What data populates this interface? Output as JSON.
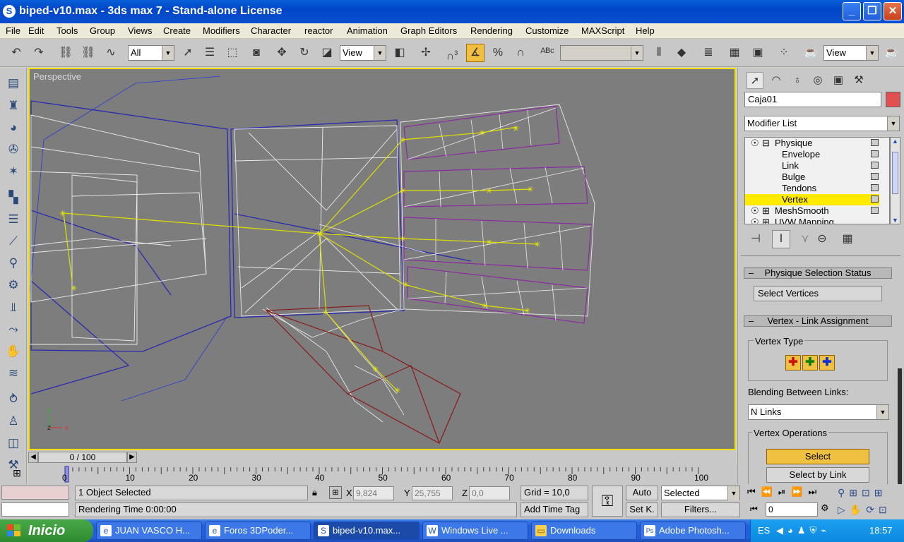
{
  "window": {
    "title": "biped-v10.max - 3ds max 7  - Stand-alone License",
    "minimize": "_",
    "maximize": "❐",
    "close": "✕"
  },
  "menu": [
    "File",
    "Edit",
    "Tools",
    "Group",
    "Views",
    "Create",
    "Modifiers",
    "Character",
    "reactor",
    "Animation",
    "Graph Editors",
    "Rendering",
    "Customize",
    "MAXScript",
    "Help"
  ],
  "toolbar": {
    "selection_filter": "All",
    "reference_coord": "View",
    "named_selection": "",
    "render_type": "View",
    "snap_label": "3"
  },
  "viewport": {
    "label": "Perspective",
    "axis_y": "y",
    "axis_z": "z",
    "axis_x": "x"
  },
  "panel": {
    "object_name": "Caja01",
    "object_color": "#e05050",
    "modifier_list": "Modifier List",
    "stack": [
      {
        "label": "Physique",
        "toggle": "⊟",
        "indent": 0,
        "bulb": true,
        "selected": false
      },
      {
        "label": "Envelope",
        "toggle": "",
        "indent": 1,
        "bulb": false,
        "selected": false
      },
      {
        "label": "Link",
        "toggle": "",
        "indent": 1,
        "bulb": false,
        "selected": false
      },
      {
        "label": "Bulge",
        "toggle": "",
        "indent": 1,
        "bulb": false,
        "selected": false
      },
      {
        "label": "Tendons",
        "toggle": "",
        "indent": 1,
        "bulb": false,
        "selected": false
      },
      {
        "label": "Vertex",
        "toggle": "",
        "indent": 1,
        "bulb": false,
        "selected": true
      },
      {
        "label": "MeshSmooth",
        "toggle": "⊞",
        "indent": 0,
        "bulb": true,
        "selected": false
      },
      {
        "label": "UVW Mapping",
        "toggle": "⊞",
        "indent": 0,
        "bulb": true,
        "selected": false
      }
    ],
    "rollout1_title": "Physique Selection Status",
    "rollout1_status": "Select Vertices",
    "rollout2_title": "Vertex - Link Assignment",
    "vertex_type_label": "Vertex Type",
    "blending_label": "Blending Between Links:",
    "blending_value": "N Links",
    "vertex_ops_label": "Vertex Operations",
    "select_button": "Select",
    "select_by_link_button": "Select by Link"
  },
  "timeline": {
    "frame": "0 / 100",
    "ticks": [
      "0",
      "10",
      "20",
      "30",
      "40",
      "50",
      "60",
      "70",
      "80",
      "90",
      "100"
    ]
  },
  "status": {
    "selected": "1 Object Selected",
    "rendering": "Rendering Time  0:00:00",
    "x_label": "X",
    "x": "9,824",
    "y_label": "Y",
    "y": "25,755",
    "z_label": "Z",
    "z": "0,0",
    "grid": "Grid = 10,0",
    "add_time_tag": "Add Time Tag",
    "auto": "Auto",
    "set_key": "Set K.",
    "key_mode": "Selected",
    "filters": "Filters...",
    "current_frame": "0"
  },
  "taskbar": {
    "start": "Inicio",
    "tasks": [
      {
        "label": "JUAN VASCO H...",
        "icon": "e",
        "active": false
      },
      {
        "label": "Foros 3DPoder...",
        "icon": "e",
        "active": false
      },
      {
        "label": "biped-v10.max...",
        "icon": "S",
        "active": true
      },
      {
        "label": "Windows Live ...",
        "icon": "W",
        "active": false
      },
      {
        "label": "Downloads",
        "icon": "▭",
        "active": false
      },
      {
        "label": "Adobe Photosh...",
        "icon": "Ps",
        "active": false
      }
    ],
    "lang": "ES",
    "clock": "18:57"
  }
}
